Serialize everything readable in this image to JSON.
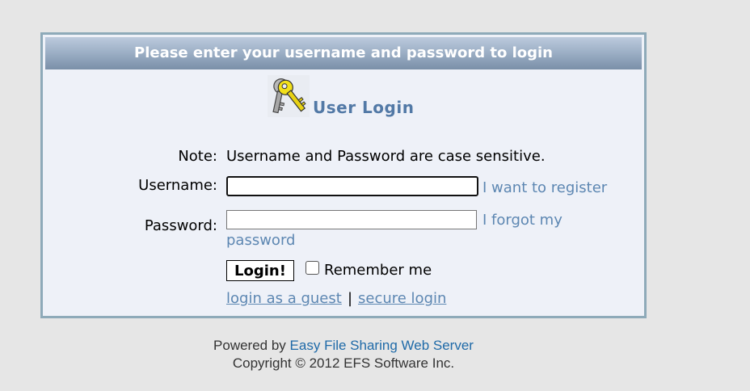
{
  "panel": {
    "header": "Please enter your username and password to login",
    "title": "User Login",
    "icon": "key-icon",
    "note_label": "Note:",
    "note_text": "Username and Password are case sensitive.",
    "username_label": "Username:",
    "username_value": "",
    "password_label": "Password:",
    "password_value": "",
    "register_link": "I want to register",
    "forgot_link_part1": "I forgot my",
    "forgot_link_part2": "password",
    "login_button": "Login!",
    "remember_label": "Remember me",
    "remember_checked": false,
    "guest_link": "login as a guest",
    "separator": "|",
    "secure_link": "secure login"
  },
  "footer": {
    "powered_by": "Powered by",
    "product_link": "Easy File Sharing Web Server",
    "copyright": "Copyright © 2012 EFS Software Inc."
  },
  "colors": {
    "background": "#e6e6e6",
    "panel_bg": "#eef1f8",
    "panel_border": "#8eaab9",
    "header_gradient_top": "#bccadd",
    "header_gradient_bottom": "#7a8fa8",
    "link": "#5d87b2",
    "title": "#5279a6",
    "footer_link": "#1f6aa8"
  }
}
